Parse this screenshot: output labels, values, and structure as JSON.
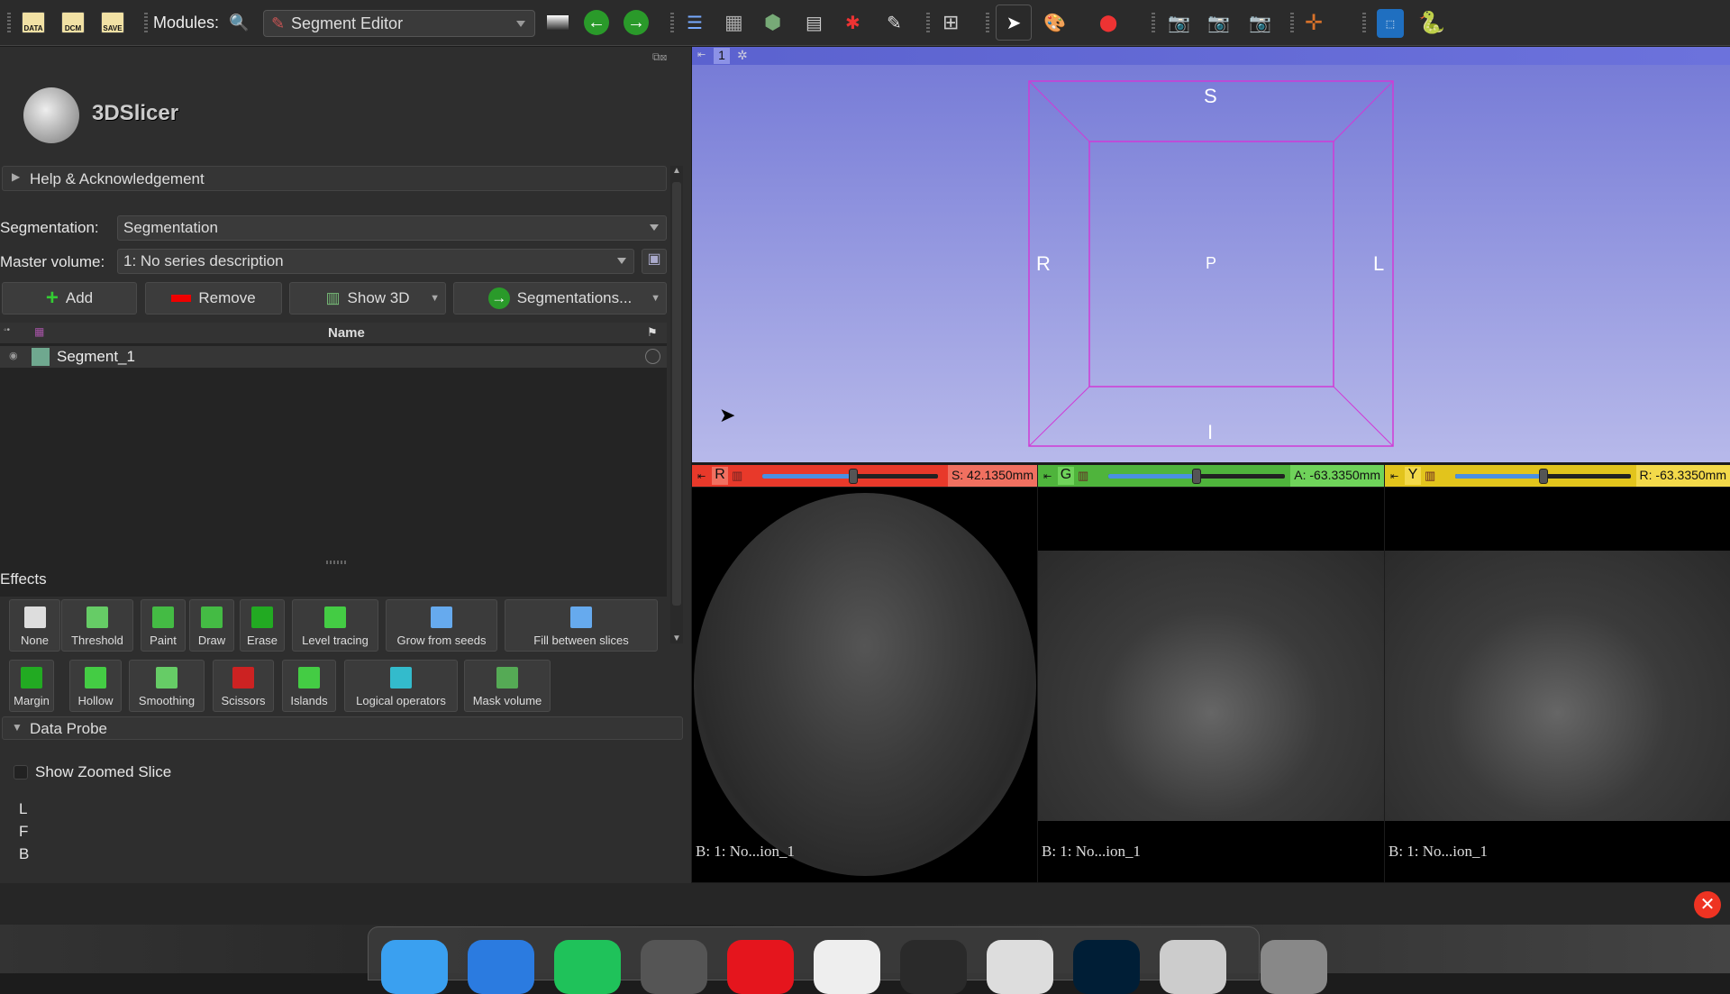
{
  "toolbar": {
    "data": "DATA",
    "dcm": "DCM",
    "save": "SAVE",
    "modules_label": "Modules:",
    "module_selected": "Segment Editor"
  },
  "logo": {
    "text": "3DSlicer"
  },
  "help": {
    "label": "Help & Acknowledgement"
  },
  "segmentation": {
    "label": "Segmentation:",
    "value": "Segmentation"
  },
  "master_volume": {
    "label": "Master volume:",
    "value": "1: No series description"
  },
  "buttons": {
    "add": "Add",
    "remove": "Remove",
    "show3d": "Show 3D",
    "segmentations": "Segmentations..."
  },
  "table": {
    "name_header": "Name",
    "rows": [
      {
        "name": "Segment_1",
        "color": "#6fa88f"
      }
    ]
  },
  "effects": {
    "title": "Effects",
    "row1": [
      "None",
      "Threshold",
      "Paint",
      "Draw",
      "Erase",
      "Level tracing",
      "Grow from seeds",
      "Fill between slices"
    ],
    "row2": [
      "Margin",
      "Hollow",
      "Smoothing",
      "Scissors",
      "Islands",
      "Logical operators",
      "Mask volume"
    ]
  },
  "data_probe": {
    "title": "Data Probe",
    "show_zoomed": "Show Zoomed Slice",
    "lines": [
      "L",
      "F",
      "B"
    ]
  },
  "view3d": {
    "tab": "1",
    "labels": {
      "top": "S",
      "bottom": "I",
      "left": "R",
      "right": "L",
      "center": "P"
    }
  },
  "slices": [
    {
      "letter": "R",
      "offset": "S: 42.1350mm",
      "color": "#e8392a",
      "offset_bg": "#f07060",
      "position": 0.52,
      "label": "B: 1: No...ion_1"
    },
    {
      "letter": "G",
      "offset": "A: -63.3350mm",
      "color": "#4fb43c",
      "offset_bg": "#6fd35a",
      "position": 0.5,
      "label": "B: 1: No...ion_1"
    },
    {
      "letter": "Y",
      "offset": "R: -63.3350mm",
      "color": "#e2c41c",
      "offset_bg": "#f3d94a",
      "position": 0.5,
      "label": "B: 1: No...ion_1"
    }
  ],
  "dock": {
    "apps": [
      "finder",
      "safari",
      "wechat",
      "screen-app",
      "youdao",
      "keynote",
      "photon",
      "rocket",
      "photoshop",
      "3dslicer",
      "trash"
    ]
  }
}
